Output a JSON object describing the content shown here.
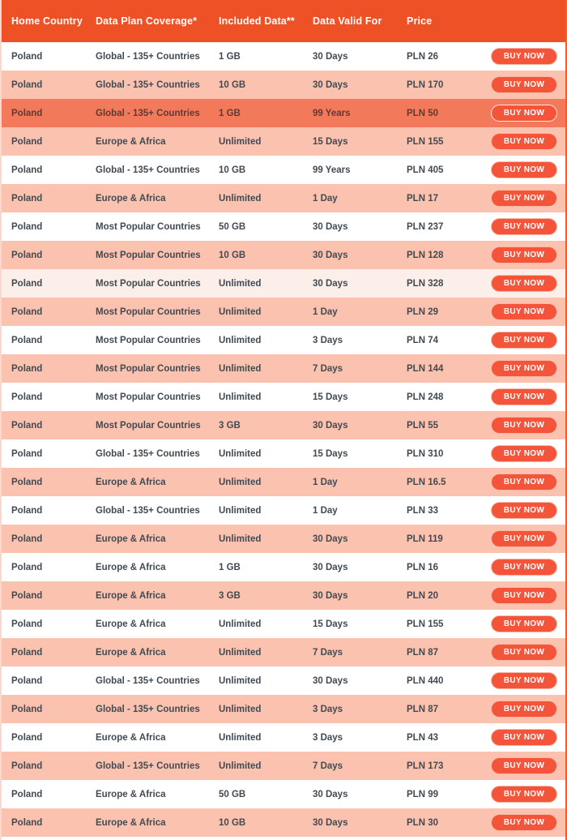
{
  "table": {
    "columns": [
      {
        "key": "country",
        "label": "Home Country"
      },
      {
        "key": "coverage",
        "label": "Data Plan Coverage*"
      },
      {
        "key": "data",
        "label": "Included Data**"
      },
      {
        "key": "valid",
        "label": "Data Valid For"
      },
      {
        "key": "price",
        "label": "Price"
      },
      {
        "key": "action",
        "label": ""
      }
    ],
    "buy_label": "BUY NOW",
    "colors": {
      "header_bg": "#ef5126",
      "header_text": "#ffffff",
      "row_white": "#ffffff",
      "row_tint": "#fcefea",
      "row_pink": "#fbc3af",
      "row_highlight": "#f2795a",
      "button_bg": "#f4543a",
      "button_text": "#ffffff",
      "cell_text": "#414a53",
      "border_right": "#ef5a30",
      "border_left": "#f9d9cd"
    },
    "rows": [
      {
        "country": "Poland",
        "coverage": "Global - 135+ Countries",
        "data": "1 GB",
        "valid": "30 Days",
        "price": "PLN 26",
        "band": "white"
      },
      {
        "country": "Poland",
        "coverage": "Global - 135+ Countries",
        "data": "10 GB",
        "valid": "30 Days",
        "price": "PLN 170",
        "band": "pink"
      },
      {
        "country": "Poland",
        "coverage": "Global - 135+ Countries",
        "data": "1 GB",
        "valid": "99 Years",
        "price": "PLN 50",
        "band": "hl"
      },
      {
        "country": "Poland",
        "coverage": "Europe & Africa",
        "data": "Unlimited",
        "valid": "15 Days",
        "price": "PLN 155",
        "band": "pink"
      },
      {
        "country": "Poland",
        "coverage": "Global - 135+ Countries",
        "data": "10 GB",
        "valid": "99 Years",
        "price": "PLN 405",
        "band": "white"
      },
      {
        "country": "Poland",
        "coverage": "Europe & Africa",
        "data": "Unlimited",
        "valid": "1 Day",
        "price": "PLN 17",
        "band": "pink"
      },
      {
        "country": "Poland",
        "coverage": "Most Popular Countries",
        "data": "50 GB",
        "valid": "30 Days",
        "price": "PLN 237",
        "band": "white"
      },
      {
        "country": "Poland",
        "coverage": "Most Popular Countries",
        "data": "10 GB",
        "valid": "30 Days",
        "price": "PLN 128",
        "band": "pink"
      },
      {
        "country": "Poland",
        "coverage": "Most Popular Countries",
        "data": "Unlimited",
        "valid": "30 Days",
        "price": "PLN 328",
        "band": "tint"
      },
      {
        "country": "Poland",
        "coverage": "Most Popular Countries",
        "data": "Unlimited",
        "valid": "1 Day",
        "price": "PLN 29",
        "band": "pink"
      },
      {
        "country": "Poland",
        "coverage": "Most Popular Countries",
        "data": "Unlimited",
        "valid": "3 Days",
        "price": "PLN 74",
        "band": "white"
      },
      {
        "country": "Poland",
        "coverage": "Most Popular Countries",
        "data": "Unlimited",
        "valid": "7 Days",
        "price": "PLN 144",
        "band": "pink"
      },
      {
        "country": "Poland",
        "coverage": "Most Popular Countries",
        "data": "Unlimited",
        "valid": "15 Days",
        "price": "PLN 248",
        "band": "white"
      },
      {
        "country": "Poland",
        "coverage": "Most Popular Countries",
        "data": "3 GB",
        "valid": "30 Days",
        "price": "PLN 55",
        "band": "pink"
      },
      {
        "country": "Poland",
        "coverage": "Global - 135+ Countries",
        "data": "Unlimited",
        "valid": "15 Days",
        "price": "PLN 310",
        "band": "white"
      },
      {
        "country": "Poland",
        "coverage": "Europe & Africa",
        "data": "Unlimited",
        "valid": "1 Day",
        "price": "PLN 16.5",
        "band": "pink"
      },
      {
        "country": "Poland",
        "coverage": "Global - 135+ Countries",
        "data": "Unlimited",
        "valid": "1 Day",
        "price": "PLN 33",
        "band": "white"
      },
      {
        "country": "Poland",
        "coverage": "Europe & Africa",
        "data": "Unlimited",
        "valid": "30 Days",
        "price": "PLN 119",
        "band": "pink"
      },
      {
        "country": "Poland",
        "coverage": "Europe & Africa",
        "data": "1 GB",
        "valid": "30 Days",
        "price": "PLN 16",
        "band": "white"
      },
      {
        "country": "Poland",
        "coverage": "Europe & Africa",
        "data": "3 GB",
        "valid": "30 Days",
        "price": "PLN 20",
        "band": "pink"
      },
      {
        "country": "Poland",
        "coverage": "Europe & Africa",
        "data": "Unlimited",
        "valid": "15 Days",
        "price": "PLN 155",
        "band": "white"
      },
      {
        "country": "Poland",
        "coverage": "Europe & Africa",
        "data": "Unlimited",
        "valid": "7 Days",
        "price": "PLN 87",
        "band": "pink"
      },
      {
        "country": "Poland",
        "coverage": "Global - 135+ Countries",
        "data": "Unlimited",
        "valid": "30 Days",
        "price": "PLN 440",
        "band": "white"
      },
      {
        "country": "Poland",
        "coverage": "Global - 135+ Countries",
        "data": "Unlimited",
        "valid": "3 Days",
        "price": "PLN 87",
        "band": "pink"
      },
      {
        "country": "Poland",
        "coverage": "Europe & Africa",
        "data": "Unlimited",
        "valid": "3 Days",
        "price": "PLN 43",
        "band": "white"
      },
      {
        "country": "Poland",
        "coverage": "Global - 135+ Countries",
        "data": "Unlimited",
        "valid": "7 Days",
        "price": "PLN 173",
        "band": "pink"
      },
      {
        "country": "Poland",
        "coverage": "Europe & Africa",
        "data": "50 GB",
        "valid": "30 Days",
        "price": "PLN 99",
        "band": "white"
      },
      {
        "country": "Poland",
        "coverage": "Europe & Africa",
        "data": "10 GB",
        "valid": "30 Days",
        "price": "PLN 30",
        "band": "pink"
      }
    ]
  }
}
